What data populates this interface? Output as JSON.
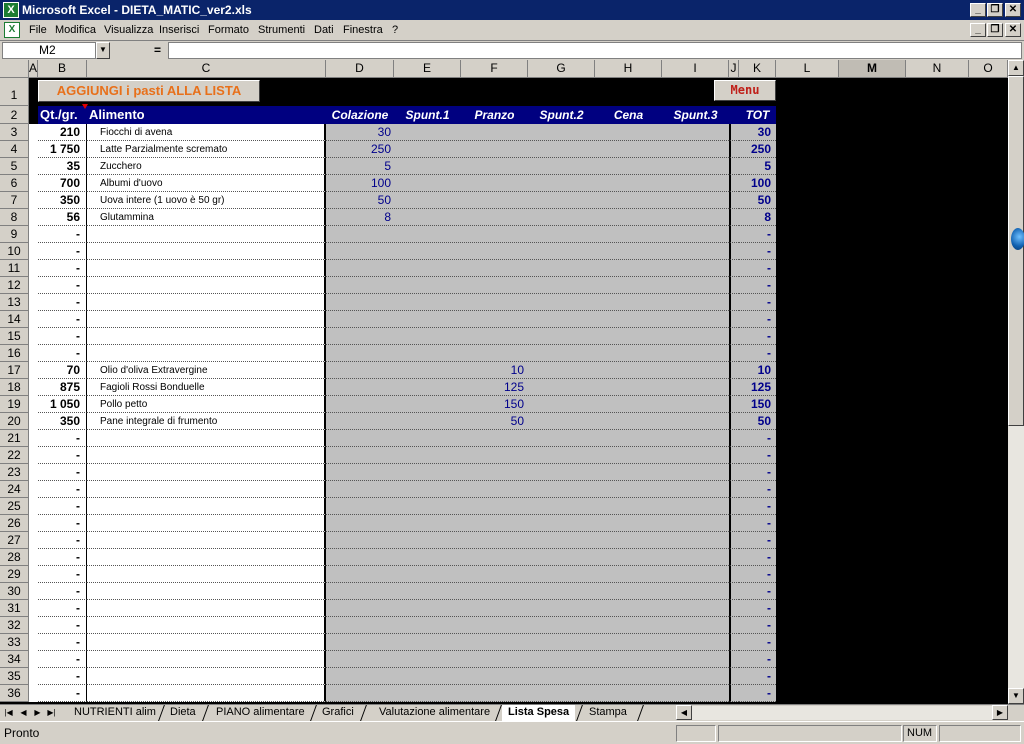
{
  "window": {
    "app_icon": "X",
    "title": "Microsoft Excel - DIETA_MATIC_ver2.xls",
    "min": "_",
    "restore": "❐",
    "close": "✕"
  },
  "menubar": {
    "items": [
      "File",
      "Modifica",
      "Visualizza",
      "Inserisci",
      "Formato",
      "Strumenti",
      "Dati",
      "Finestra",
      "?"
    ]
  },
  "formula_bar": {
    "name_box": "M2",
    "equals": "="
  },
  "columns": [
    "A",
    "B",
    "C",
    "D",
    "E",
    "F",
    "G",
    "H",
    "I",
    "J",
    "K",
    "L",
    "M",
    "N",
    "O"
  ],
  "selected_column": "M",
  "buttons": {
    "add_meals": "AGGIUNGI i pasti ALLA LISTA",
    "menu": "Menu"
  },
  "table_header": {
    "qty": "Qt./gr.",
    "food": "Alimento",
    "colazione": "Colazione",
    "spunt1": "Spunt.1",
    "pranzo": "Pranzo",
    "spunt2": "Spunt.2",
    "cena": "Cena",
    "spunt3": "Spunt.3",
    "tot": "TOT"
  },
  "rows": [
    {
      "n": "3",
      "qty": "210",
      "food": "Fiocchi di avena",
      "colazione": "30",
      "pranzo": "",
      "tot": "30"
    },
    {
      "n": "4",
      "qty": "1 750",
      "food": "Latte Parzialmente scremato",
      "colazione": "250",
      "pranzo": "",
      "tot": "250"
    },
    {
      "n": "5",
      "qty": "35",
      "food": "Zucchero",
      "colazione": "5",
      "pranzo": "",
      "tot": "5"
    },
    {
      "n": "6",
      "qty": "700",
      "food": "Albumi d'uovo",
      "colazione": "100",
      "pranzo": "",
      "tot": "100"
    },
    {
      "n": "7",
      "qty": "350",
      "food": "Uova intere (1 uovo è 50 gr)",
      "colazione": "50",
      "pranzo": "",
      "tot": "50"
    },
    {
      "n": "8",
      "qty": "56",
      "food": "Glutammina",
      "colazione": "8",
      "pranzo": "",
      "tot": "8"
    },
    {
      "n": "9",
      "qty": "-",
      "food": "",
      "colazione": "",
      "pranzo": "",
      "tot": "-"
    },
    {
      "n": "10",
      "qty": "-",
      "food": "",
      "colazione": "",
      "pranzo": "",
      "tot": "-"
    },
    {
      "n": "11",
      "qty": "-",
      "food": "",
      "colazione": "",
      "pranzo": "",
      "tot": "-"
    },
    {
      "n": "12",
      "qty": "-",
      "food": "",
      "colazione": "",
      "pranzo": "",
      "tot": "-"
    },
    {
      "n": "13",
      "qty": "-",
      "food": "",
      "colazione": "",
      "pranzo": "",
      "tot": "-"
    },
    {
      "n": "14",
      "qty": "-",
      "food": "",
      "colazione": "",
      "pranzo": "",
      "tot": "-"
    },
    {
      "n": "15",
      "qty": "-",
      "food": "",
      "colazione": "",
      "pranzo": "",
      "tot": "-"
    },
    {
      "n": "16",
      "qty": "-",
      "food": "",
      "colazione": "",
      "pranzo": "",
      "tot": "-"
    },
    {
      "n": "17",
      "qty": "70",
      "food": "Olio d'oliva Extravergine",
      "colazione": "",
      "pranzo": "10",
      "tot": "10"
    },
    {
      "n": "18",
      "qty": "875",
      "food": "Fagioli Rossi Bonduelle",
      "colazione": "",
      "pranzo": "125",
      "tot": "125"
    },
    {
      "n": "19",
      "qty": "1 050",
      "food": "Pollo petto",
      "colazione": "",
      "pranzo": "150",
      "tot": "150"
    },
    {
      "n": "20",
      "qty": "350",
      "food": "Pane integrale di frumento",
      "colazione": "",
      "pranzo": "50",
      "tot": "50"
    },
    {
      "n": "21",
      "qty": "-",
      "food": "",
      "colazione": "",
      "pranzo": "",
      "tot": "-"
    },
    {
      "n": "22",
      "qty": "-",
      "food": "",
      "colazione": "",
      "pranzo": "",
      "tot": "-"
    },
    {
      "n": "23",
      "qty": "-",
      "food": "",
      "colazione": "",
      "pranzo": "",
      "tot": "-"
    },
    {
      "n": "24",
      "qty": "-",
      "food": "",
      "colazione": "",
      "pranzo": "",
      "tot": "-"
    },
    {
      "n": "25",
      "qty": "-",
      "food": "",
      "colazione": "",
      "pranzo": "",
      "tot": "-"
    },
    {
      "n": "26",
      "qty": "-",
      "food": "",
      "colazione": "",
      "pranzo": "",
      "tot": "-"
    },
    {
      "n": "27",
      "qty": "-",
      "food": "",
      "colazione": "",
      "pranzo": "",
      "tot": "-"
    },
    {
      "n": "28",
      "qty": "-",
      "food": "",
      "colazione": "",
      "pranzo": "",
      "tot": "-"
    },
    {
      "n": "29",
      "qty": "-",
      "food": "",
      "colazione": "",
      "pranzo": "",
      "tot": "-"
    },
    {
      "n": "30",
      "qty": "-",
      "food": "",
      "colazione": "",
      "pranzo": "",
      "tot": "-"
    },
    {
      "n": "31",
      "qty": "-",
      "food": "",
      "colazione": "",
      "pranzo": "",
      "tot": "-"
    },
    {
      "n": "32",
      "qty": "-",
      "food": "",
      "colazione": "",
      "pranzo": "",
      "tot": "-"
    },
    {
      "n": "33",
      "qty": "-",
      "food": "",
      "colazione": "",
      "pranzo": "",
      "tot": "-"
    },
    {
      "n": "34",
      "qty": "-",
      "food": "",
      "colazione": "",
      "pranzo": "",
      "tot": "-"
    },
    {
      "n": "35",
      "qty": "-",
      "food": "",
      "colazione": "",
      "pranzo": "",
      "tot": "-"
    },
    {
      "n": "36",
      "qty": "-",
      "food": "",
      "colazione": "",
      "pranzo": "",
      "tot": "-"
    }
  ],
  "sheet_tabs": [
    "NUTRIENTI alim",
    "Dieta",
    "PIANO alimentare",
    "Grafici",
    "Valutazione alimentare",
    "Lista Spesa",
    "Stampa"
  ],
  "active_tab": "Lista Spesa",
  "tab_nav": [
    "|◀",
    "◀",
    "▶",
    "▶|"
  ],
  "status": {
    "text": "Pronto",
    "num": "NUM"
  },
  "colors": {
    "header_blue": "#000080",
    "value_blue": "#00008b",
    "add_button_text": "#e8701a",
    "menu_button_text": "#c0201a",
    "gray_cells": "#c0c0c0"
  }
}
